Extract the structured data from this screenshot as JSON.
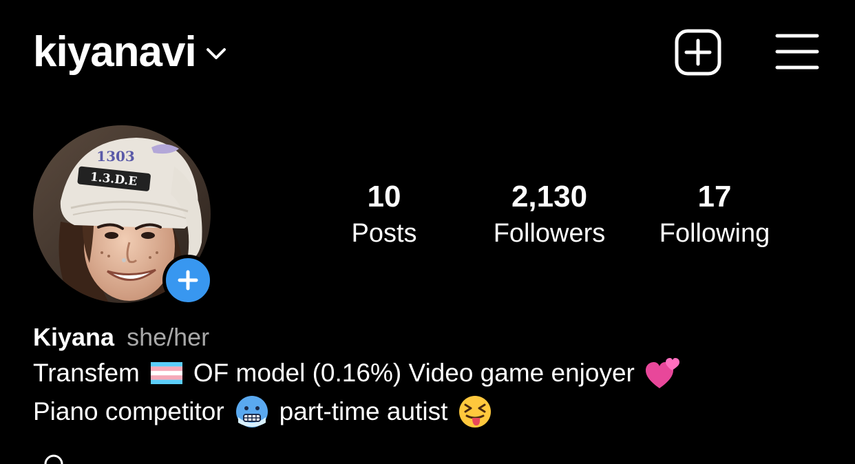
{
  "header": {
    "username": "kiyanavi",
    "icons": [
      "chevron-down-icon",
      "add-post-icon",
      "hamburger-menu-icon"
    ]
  },
  "stats": {
    "posts": {
      "count": "10",
      "label": "Posts"
    },
    "followers": {
      "count": "2,130",
      "label": "Followers"
    },
    "following": {
      "count": "17",
      "label": "Following"
    }
  },
  "profile": {
    "display_name": "Kiyana",
    "pronouns": "she/her",
    "bio_line_1": {
      "part_a": "Transfem",
      "part_b": "OF model (0.16%) Video game enjoyer"
    },
    "bio_line_2": {
      "part_a": "Piano competitor",
      "part_b": "part-time autist"
    },
    "emojis": [
      "transgender-flag",
      "two-hearts",
      "cold-face",
      "squinting-tongue-face"
    ],
    "avatar_hat_text": {
      "top": "1303",
      "patch": "1.3.D.E"
    }
  },
  "colors": {
    "background": "#000000",
    "text": "#ffffff",
    "secondary_text": "#a8a8a8",
    "accent_blue": "#3897f0"
  }
}
